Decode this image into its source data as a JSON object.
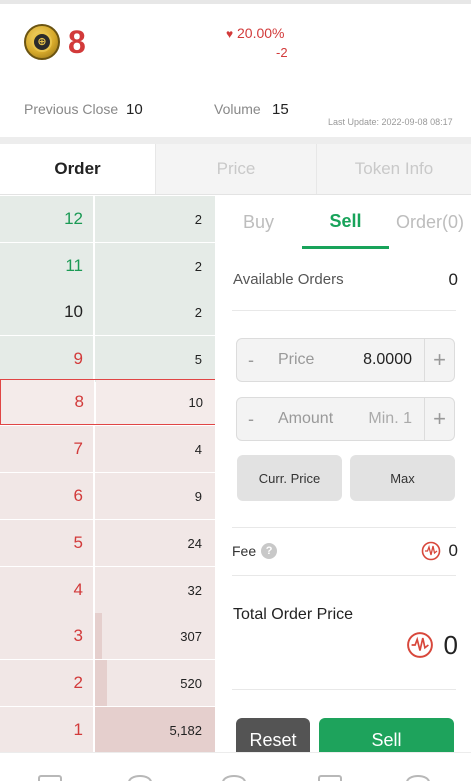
{
  "header": {
    "price": "8",
    "change_pct": "20.00%",
    "change_arrow": "♥",
    "change_abs": "-2",
    "prev_close_label": "Previous Close",
    "prev_close_value": "10",
    "volume_label": "Volume",
    "volume_value": "15",
    "last_update": "Last Update: 2022-09-08 08:17"
  },
  "main_tabs": [
    {
      "label": "Order",
      "active": true
    },
    {
      "label": "Price",
      "active": false
    },
    {
      "label": "Token Info",
      "active": false
    }
  ],
  "order_book": [
    {
      "price": "12",
      "qty": "2",
      "side": "buy"
    },
    {
      "price": "11",
      "qty": "2",
      "side": "buy"
    },
    {
      "price": "10",
      "qty": "2",
      "side": "buy"
    },
    {
      "price": "9",
      "qty": "5",
      "side": "buy"
    },
    {
      "price": "8",
      "qty": "10",
      "side": "sell",
      "current": true
    },
    {
      "price": "7",
      "qty": "4",
      "side": "sell"
    },
    {
      "price": "6",
      "qty": "9",
      "side": "sell"
    },
    {
      "price": "5",
      "qty": "24",
      "side": "sell"
    },
    {
      "price": "4",
      "qty": "32",
      "side": "sell"
    },
    {
      "price": "3",
      "qty": "307",
      "side": "sell",
      "depth": 0.06
    },
    {
      "price": "2",
      "qty": "520",
      "side": "sell",
      "depth": 0.1
    },
    {
      "price": "1",
      "qty": "5,182",
      "side": "sell",
      "depth": 1.0
    }
  ],
  "trade_tabs": [
    {
      "label": "Buy",
      "active": false
    },
    {
      "label": "Sell",
      "active": true
    },
    {
      "label": "Order(0)",
      "active": false
    }
  ],
  "form": {
    "available_label": "Available Orders",
    "available_value": "0",
    "price_label": "Price",
    "price_value": "8.0000",
    "amount_label": "Amount",
    "amount_placeholder": "Min. 1",
    "minus": "-",
    "plus": "+",
    "curr_price_label": "Curr. Price",
    "max_label": "Max",
    "fee_label": "Fee",
    "fee_help": "?",
    "fee_value": "0",
    "total_label": "Total Order Price",
    "total_value": "0",
    "reset_label": "Reset",
    "sell_label": "Sell"
  },
  "colors": {
    "up_red": "#d23a3a",
    "accent_green": "#1ea35c",
    "buy_row_bg": "#e5ebe7",
    "sell_row_bg": "#f1e7e6"
  }
}
